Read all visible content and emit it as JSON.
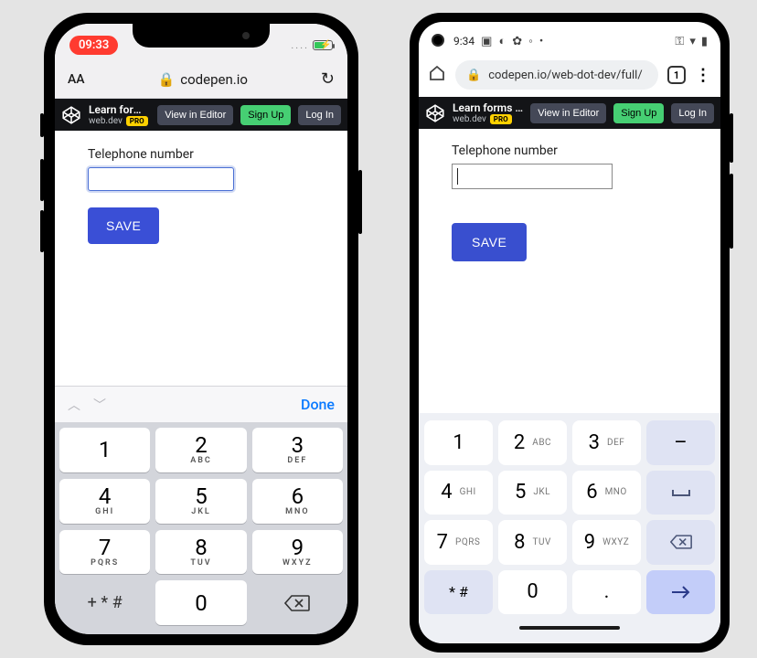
{
  "ios": {
    "status": {
      "time": "09:33",
      "signal_dots": "...."
    },
    "url": {
      "domain": "codepen.io"
    },
    "codepen": {
      "title": "Learn forms – virt...",
      "author": "web.dev",
      "pro_badge": "PRO",
      "view_in_editor": "View in Editor",
      "sign_up": "Sign Up",
      "log_in": "Log In"
    },
    "form": {
      "label": "Telephone number",
      "value": "",
      "save": "SAVE"
    },
    "keyboard": {
      "done": "Done",
      "keys": {
        "1": {
          "n": "1",
          "s": ""
        },
        "2": {
          "n": "2",
          "s": "ABC"
        },
        "3": {
          "n": "3",
          "s": "DEF"
        },
        "4": {
          "n": "4",
          "s": "GHI"
        },
        "5": {
          "n": "5",
          "s": "JKL"
        },
        "6": {
          "n": "6",
          "s": "MNO"
        },
        "7": {
          "n": "7",
          "s": "PQRS"
        },
        "8": {
          "n": "8",
          "s": "TUV"
        },
        "9": {
          "n": "9",
          "s": "WXYZ"
        },
        "sym": "+ * #",
        "0": {
          "n": "0",
          "s": ""
        }
      }
    }
  },
  "android": {
    "status": {
      "time": "9:34"
    },
    "url": {
      "full": "codepen.io/web-dot-dev/full/",
      "tab_count": "1"
    },
    "codepen": {
      "title": "Learn forms – virt...",
      "author": "web.dev",
      "pro_badge": "PRO",
      "view_in_editor": "View in Editor",
      "sign_up": "Sign Up",
      "log_in": "Log In"
    },
    "form": {
      "label": "Telephone number",
      "value": "",
      "save": "SAVE"
    },
    "keyboard": {
      "keys": {
        "1": {
          "n": "1",
          "s": ""
        },
        "2": {
          "n": "2",
          "s": "ABC"
        },
        "3": {
          "n": "3",
          "s": "DEF"
        },
        "dash": "–",
        "4": {
          "n": "4",
          "s": "GHI"
        },
        "5": {
          "n": "5",
          "s": "JKL"
        },
        "6": {
          "n": "6",
          "s": "MNO"
        },
        "space": "⎵",
        "7": {
          "n": "7",
          "s": "PQRS"
        },
        "8": {
          "n": "8",
          "s": "TUV"
        },
        "9": {
          "n": "9",
          "s": "WXYZ"
        },
        "star": "* #",
        "0": {
          "n": "0",
          "s": ""
        },
        "dot": ".",
        "go": "→"
      }
    }
  }
}
